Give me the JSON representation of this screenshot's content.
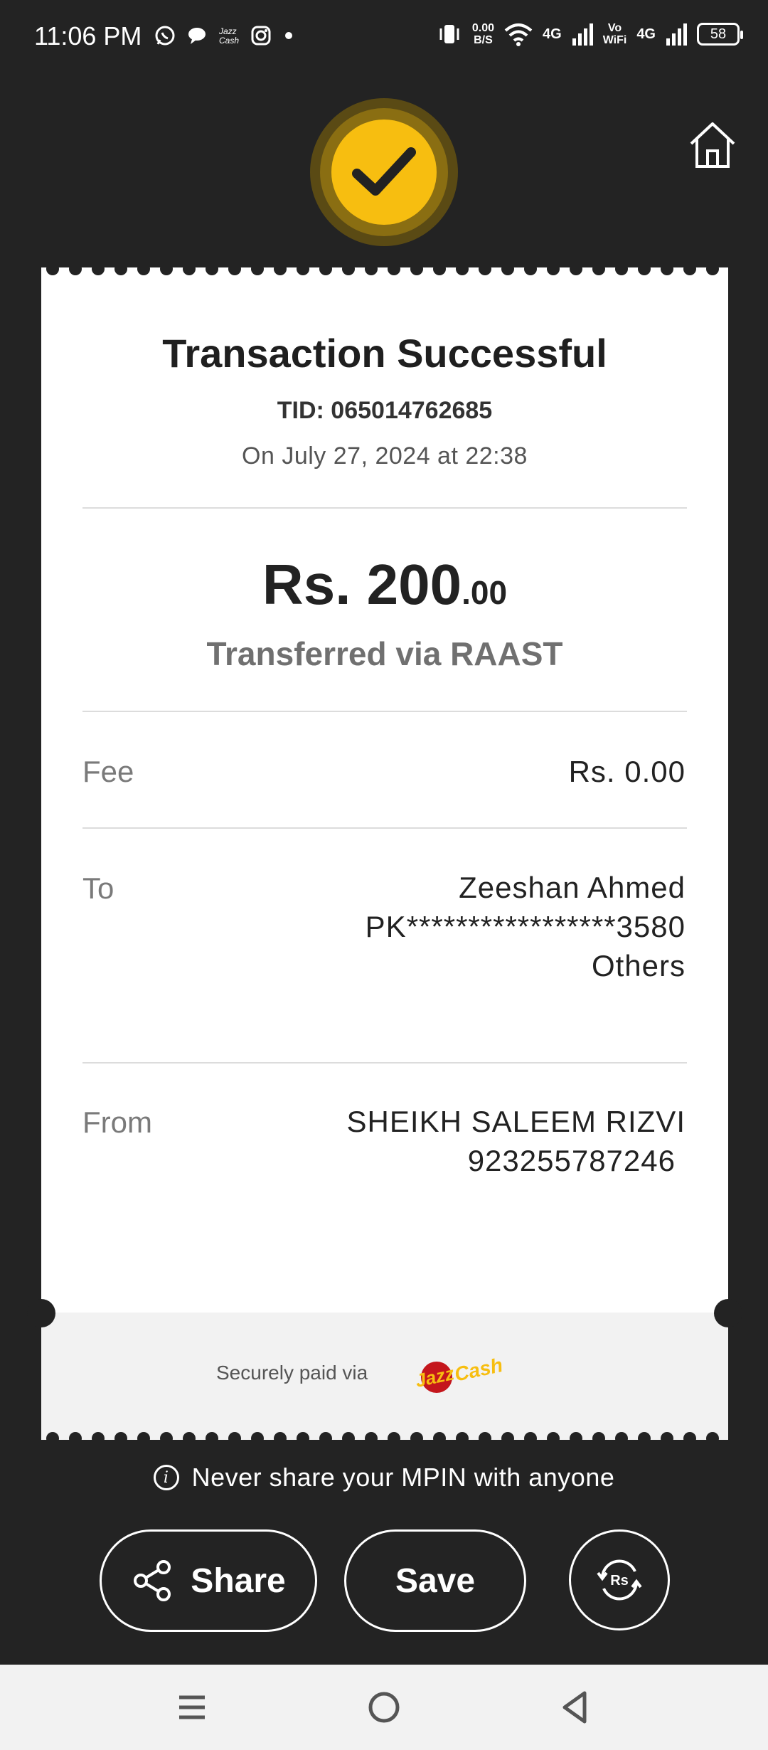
{
  "status_bar": {
    "time": "11:06 PM",
    "net_speed_value": "0.00",
    "net_speed_unit": "B/S",
    "net_4g_1": "4G",
    "vo_label": "Vo",
    "wifi_label": "WiFi",
    "net_4g_2": "4G",
    "battery": "58",
    "left_icons": [
      "whatsapp-icon",
      "chat-icon",
      "jazzcash-icon",
      "instagram-icon",
      "dot-icon"
    ]
  },
  "receipt": {
    "title": "Transaction Successful",
    "tid": "TID: 065014762685",
    "date": "On July 27, 2024 at 22:38",
    "amount_main": "Rs. 200",
    "amount_decimal": ".00",
    "transferred_via": "Transferred via RAAST",
    "fee_label": "Fee",
    "fee_value": "Rs. 0.00",
    "to_label": "To",
    "to_name": "Zeeshan Ahmed",
    "to_account": "PK*****************3580",
    "to_bank": "Others",
    "from_label": "From",
    "from_name": "SHEIKH SALEEM RIZVI",
    "from_number": "923255787246",
    "securely_paid": "Securely paid via",
    "logo_text_1": "Jazz",
    "logo_text_2": "Cash"
  },
  "warning": "Never share your MPIN with anyone",
  "actions": {
    "share": "Share",
    "save": "Save",
    "refund_icon_text": "Rs"
  },
  "colors": {
    "accent": "#F7BE10",
    "background": "#232323",
    "card": "#FFFFFF"
  }
}
